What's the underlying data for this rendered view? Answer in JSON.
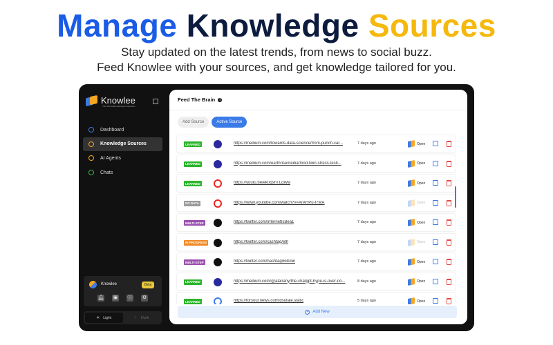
{
  "hero": {
    "title_1": "Manage",
    "title_2": "Knowledge",
    "title_3": "Sources",
    "line1": "Stay updated on the latest trends, from news to social buzz.",
    "line2": "Feed Knowlee with your sources, and get knowledge tailored for you."
  },
  "sidebar": {
    "brand": "Knowlee",
    "tagline": "Your Personal Learning Companion",
    "items": [
      {
        "label": "Dashboard",
        "icon": "clock-icon",
        "color": "#3b7be8"
      },
      {
        "label": "Knowledge Sources",
        "icon": "brain-icon",
        "color": "#f5a623"
      },
      {
        "label": "AI Agents",
        "icon": "grid-icon",
        "color": "#f5a623"
      },
      {
        "label": "Chats",
        "icon": "chat-icon",
        "color": "#2fbf4a"
      }
    ],
    "user": {
      "name": "Knowlee",
      "badge": "Beta"
    },
    "theme": {
      "light": "Light",
      "dark": "Dark"
    }
  },
  "main": {
    "title": "Feed The Brain",
    "tabs": [
      "Add Source",
      "Active Source"
    ],
    "open_label": "Open",
    "add_new": "Add New",
    "rows": [
      {
        "status": "LEARNED",
        "color": "#2ab52a",
        "source": "medium",
        "url": "https://medium.com/towards-data-science/from-punch-car...",
        "date": "7 days ago",
        "open_enabled": true
      },
      {
        "status": "LEARNED",
        "color": "#2ab52a",
        "source": "medium",
        "url": "https://medium.com/earthrisemedia/food-twin-stress-testi...",
        "date": "7 days ago",
        "open_enabled": true
      },
      {
        "status": "LEARNED",
        "color": "#2ab52a",
        "source": "youtube",
        "url": "https://youtu.be/ek0qshTLqWw",
        "date": "7 days ago",
        "open_enabled": true
      },
      {
        "status": "NO DATA",
        "color": "#9a9a9a",
        "source": "youtube",
        "url": "https://www.youtube.com/watch?v=ArAHPu-f7MA",
        "date": "7 days ago",
        "open_enabled": false
      },
      {
        "status": "MULTI-STEP",
        "color": "#9b4fb0",
        "source": "x",
        "url": "https://twitter.com/InternetIsBea1",
        "date": "7 days ago",
        "open_enabled": true
      },
      {
        "status": "IN PROGRESS",
        "color": "#f08a24",
        "source": "x",
        "url": "https://twitter.com/cashtag/eth",
        "date": "7 days ago",
        "open_enabled": false
      },
      {
        "status": "MULTI-STEP",
        "color": "#9b4fb0",
        "source": "x",
        "url": "https://twitter.com/hashtag/Bitcoin",
        "date": "7 days ago",
        "open_enabled": true
      },
      {
        "status": "LEARNED",
        "color": "#2ab52a",
        "source": "medium",
        "url": "https://medium.com/@alanany/the-chatgpt-hype-is-over-no...",
        "date": "8 days ago",
        "open_enabled": true
      },
      {
        "status": "LEARNED",
        "color": "#2ab52a",
        "source": "web",
        "url": "https://forsoul.news.com/dsufale.static",
        "date": "5 days ago",
        "open_enabled": true
      }
    ]
  }
}
